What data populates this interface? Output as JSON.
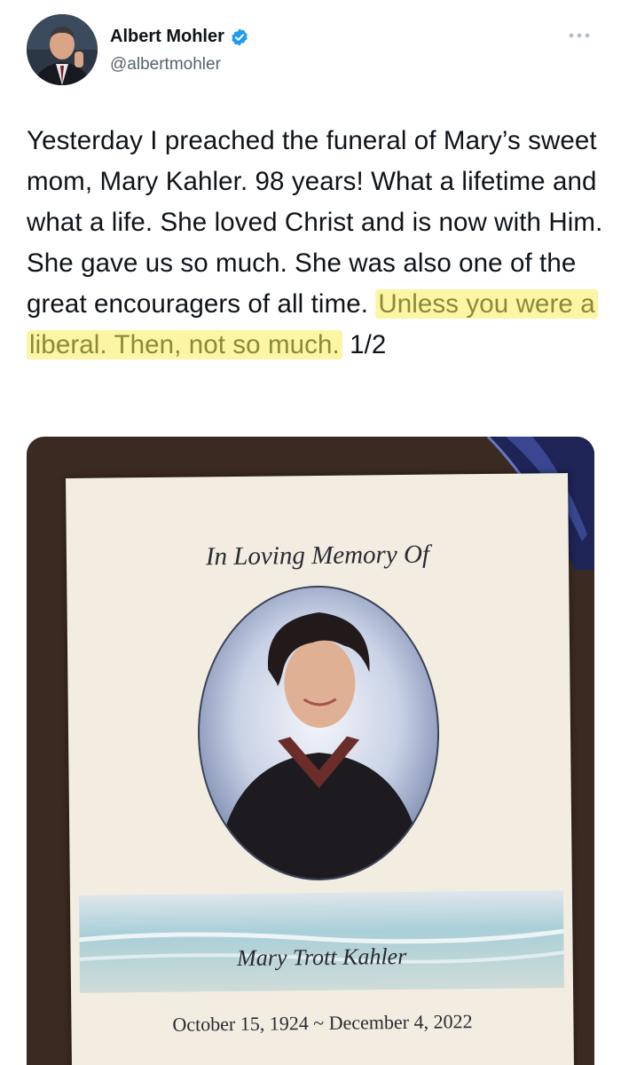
{
  "author": {
    "display_name": "Albert Mohler",
    "handle": "@albertmohler",
    "verified_icon": "verified-badge-icon",
    "avatar_icon": "profile-photo"
  },
  "menu": {
    "icon": "more-options-icon"
  },
  "tweet": {
    "text_plain": "Yesterday I preached the funeral of Mary’s sweet mom, Mary Kahler. 98 years! What a lifetime and what a life. She loved Christ and is now with Him. She gave us so much. She was also one of the great encouragers of all time.",
    "text_highlighted": "Unless you were a liberal. Then, not so much.",
    "text_suffix": "1/2"
  },
  "photo": {
    "card_title": "In Loving Memory Of",
    "card_name": "Mary Trott Kahler",
    "card_dates": "October 15, 1924 ~ December 4, 2022"
  },
  "colors": {
    "highlight": "#fbf5a4",
    "verified": "#1d9bf0",
    "text": "#0f1419",
    "muted": "#536471"
  }
}
